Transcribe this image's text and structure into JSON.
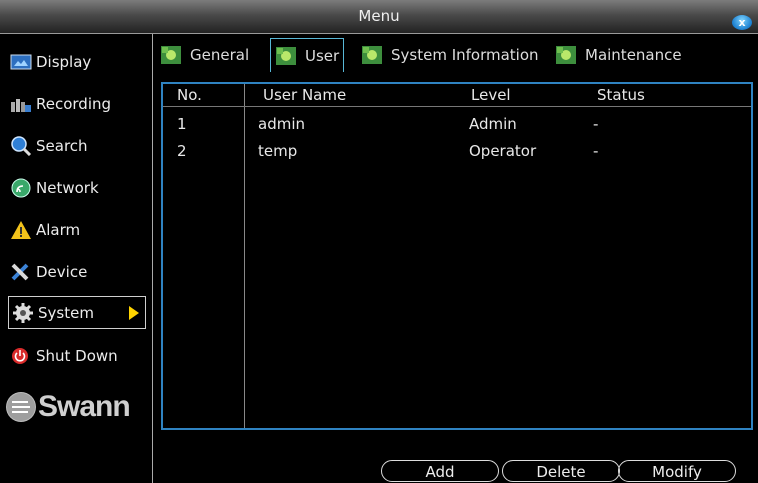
{
  "window": {
    "title": "Menu",
    "close_label": "x"
  },
  "sidebar": {
    "items": [
      {
        "label": "Display",
        "icon": "display-icon"
      },
      {
        "label": "Recording",
        "icon": "recording-icon"
      },
      {
        "label": "Search",
        "icon": "search-icon"
      },
      {
        "label": "Network",
        "icon": "network-icon"
      },
      {
        "label": "Alarm",
        "icon": "alarm-icon"
      },
      {
        "label": "Device",
        "icon": "device-icon"
      },
      {
        "label": "System",
        "icon": "gear-icon",
        "selected": true
      },
      {
        "label": "Shut Down",
        "icon": "power-icon"
      }
    ],
    "logo_text": "Swann"
  },
  "tabs": [
    {
      "label": "General"
    },
    {
      "label": "User",
      "active": true
    },
    {
      "label": "System Information"
    },
    {
      "label": "Maintenance"
    }
  ],
  "table": {
    "headers": [
      "No.",
      "User Name",
      "Level",
      "Status"
    ],
    "rows": [
      [
        "1",
        "admin",
        "Admin",
        "-"
      ],
      [
        "2",
        "temp",
        "Operator",
        "-"
      ]
    ]
  },
  "buttons": {
    "add": "Add",
    "delete": "Delete",
    "modify": "Modify"
  },
  "colors": {
    "accent": "#2f83c1",
    "arrow": "#ffd400",
    "close": "#1b7fd0"
  }
}
